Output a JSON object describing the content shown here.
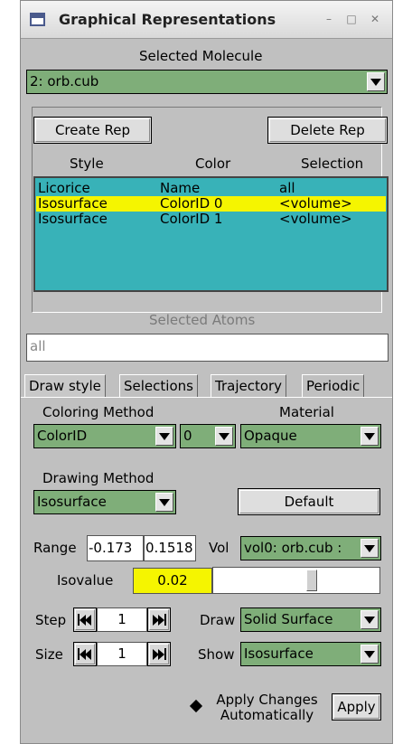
{
  "window": {
    "title": "Graphical Representations"
  },
  "selected_molecule": {
    "label": "Selected Molecule",
    "value": "2: orb.cub"
  },
  "buttons": {
    "create_rep": "Create Rep",
    "delete_rep": "Delete Rep",
    "default": "Default",
    "apply": "Apply"
  },
  "rep_table": {
    "headers": [
      "Style",
      "Color",
      "Selection"
    ],
    "rows": [
      {
        "style": "Licorice",
        "color": "Name",
        "selection": "all"
      },
      {
        "style": "Isosurface",
        "color": "ColorID 0",
        "selection": "<volume>",
        "selected": true
      },
      {
        "style": "Isosurface",
        "color": "ColorID 1",
        "selection": "<volume>"
      }
    ]
  },
  "selected_atoms": {
    "label": "Selected Atoms",
    "value": "all"
  },
  "tabs": [
    "Draw style",
    "Selections",
    "Trajectory",
    "Periodic"
  ],
  "draw_style": {
    "coloring_method_label": "Coloring Method",
    "coloring_method": "ColorID",
    "color_id": "0",
    "material_label": "Material",
    "material": "Opaque",
    "drawing_method_label": "Drawing Method",
    "drawing_method": "Isosurface",
    "range_label": "Range",
    "range_min": "-0.173",
    "range_max": "0.1518",
    "vol_label": "Vol",
    "vol": "vol0: orb.cub :",
    "isovalue_label": "Isovalue",
    "isovalue": "0.02",
    "isovalue_slider_fraction": 0.6,
    "step_label": "Step",
    "step": "1",
    "draw_label": "Draw",
    "draw": "Solid Surface",
    "size_label": "Size",
    "size": "1",
    "show_label": "Show",
    "show": "Isosurface",
    "apply_changes_label": "Apply Changes Automatically"
  },
  "colors": {
    "combo_green": "#7fae79",
    "list_teal": "#38b2b8",
    "highlight_yellow": "#f5f500"
  }
}
